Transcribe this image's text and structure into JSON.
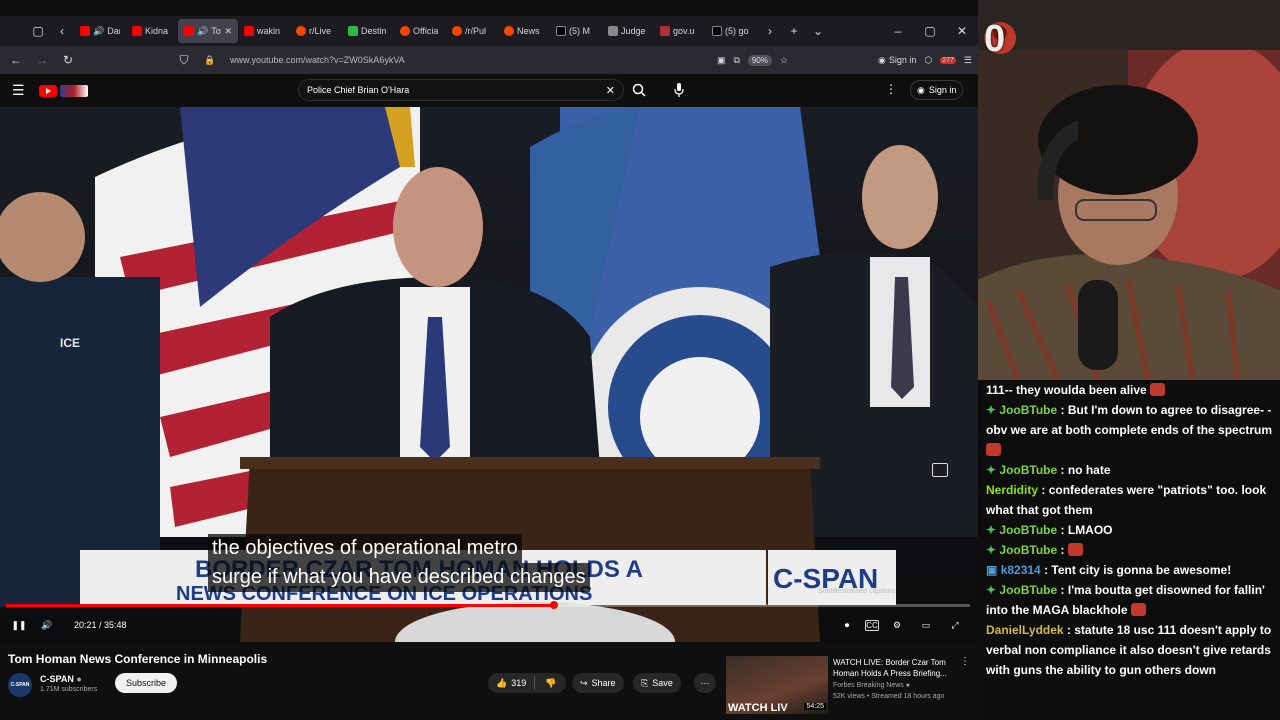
{
  "browser": {
    "tabs": [
      {
        "label": "Dark S",
        "icon": "youtube-icon",
        "audio": true
      },
      {
        "label": "Kidna",
        "icon": "youtube-icon",
        "audio": false
      },
      {
        "label": "Tom",
        "icon": "youtube-icon",
        "audio": true,
        "active": true
      },
      {
        "label": "wakin",
        "icon": "youtube-icon",
        "audio": false
      },
      {
        "label": "r/Live",
        "icon": "reddit-icon",
        "audio": false
      },
      {
        "label": "Destin",
        "icon": "destiny-icon",
        "audio": false
      },
      {
        "label": "Officia",
        "icon": "reddit-icon",
        "audio": false
      },
      {
        "label": "/r/Pul",
        "icon": "reddit-icon",
        "audio": false
      },
      {
        "label": "News",
        "icon": "reddit-icon",
        "audio": false
      },
      {
        "label": "(5) M",
        "icon": "x-icon",
        "audio": false
      },
      {
        "label": "Judge",
        "icon": "site-icon",
        "audio": false
      },
      {
        "label": "gov.u",
        "icon": "gov-icon",
        "audio": false
      },
      {
        "label": "(5) go",
        "icon": "x-icon",
        "audio": false
      }
    ],
    "url": "www.youtube.com/watch?v=ZW0SkA6ykVA",
    "zoom": "90%",
    "signin": "Sign in",
    "ext_badge": "277"
  },
  "youtube": {
    "search_value": "Police Chief Brian O'Hara",
    "signin": "Sign in",
    "video": {
      "caption_line1": "the objectives of operational metro",
      "caption_line2": "surge if what you have described changes",
      "banner_line1": "BORDER CZAR TOM HOMAN HOLDS A",
      "banner_line2": "NEWS CONFERENCE ON ICE OPERATIONS",
      "network": "C-SPAN",
      "cc_label": "Subtitles/closed captions",
      "time": "20:21 / 35:48",
      "progress": 0.568
    },
    "title": "Tom Homan News Conference in Minneapolis",
    "channel": {
      "name": "C-SPAN",
      "subs": "1.71M subscribers",
      "avatar_text": "C-SPAN"
    },
    "subscribe": "Subscribe",
    "likes": "319",
    "share": "Share",
    "save": "Save",
    "recommended": {
      "title": "WATCH LIVE: Border Czar Tom Homan Holds A Press Briefing...",
      "channel": "Forbes Breaking News",
      "meta": "52K views • Streamed 18 hours ago",
      "thumb_text": "WATCH LIV",
      "duration": "54:25"
    }
  },
  "stream": {
    "viewer_count": "0",
    "chat": [
      {
        "user": "",
        "text": "111-- they woulda been alive",
        "color": "#ffffff",
        "badge": "",
        "emote": true
      },
      {
        "user": "JooBTube",
        "text": "But I'm down to agree to disagree- - obv we are at both complete ends of the spectrum",
        "color": "#7bd348",
        "badge": "green",
        "emote": true
      },
      {
        "user": "JooBTube",
        "text": "no hate",
        "color": "#7bd348",
        "badge": "green",
        "emote": false
      },
      {
        "user": "Nerdidity",
        "text": "confederates were \"patriots\" too. look what that got them",
        "color": "#8be600",
        "badge": "",
        "emote": false
      },
      {
        "user": "JooBTube",
        "text": "LMAOO",
        "color": "#7bd348",
        "badge": "green",
        "emote": false
      },
      {
        "user": "JooBTube",
        "text": "",
        "color": "#7bd348",
        "badge": "green",
        "emote": true
      },
      {
        "user": "k82314",
        "text": "Tent city is gonna be awesome!",
        "color": "#4a9bd8",
        "badge": "blue",
        "emote": false
      },
      {
        "user": "JooBTube",
        "text": "I'ma boutta get disowned for fallin' into the MAGA blackhole",
        "color": "#7bd348",
        "badge": "green",
        "emote": true
      },
      {
        "user": "DanielLyddek",
        "text": "statute 18 usc 111 doesn't apply to verbal non compliance it also doesn't give retards with guns the ability to gun others down",
        "color": "#d4b84a",
        "badge": "",
        "emote": false
      }
    ]
  }
}
